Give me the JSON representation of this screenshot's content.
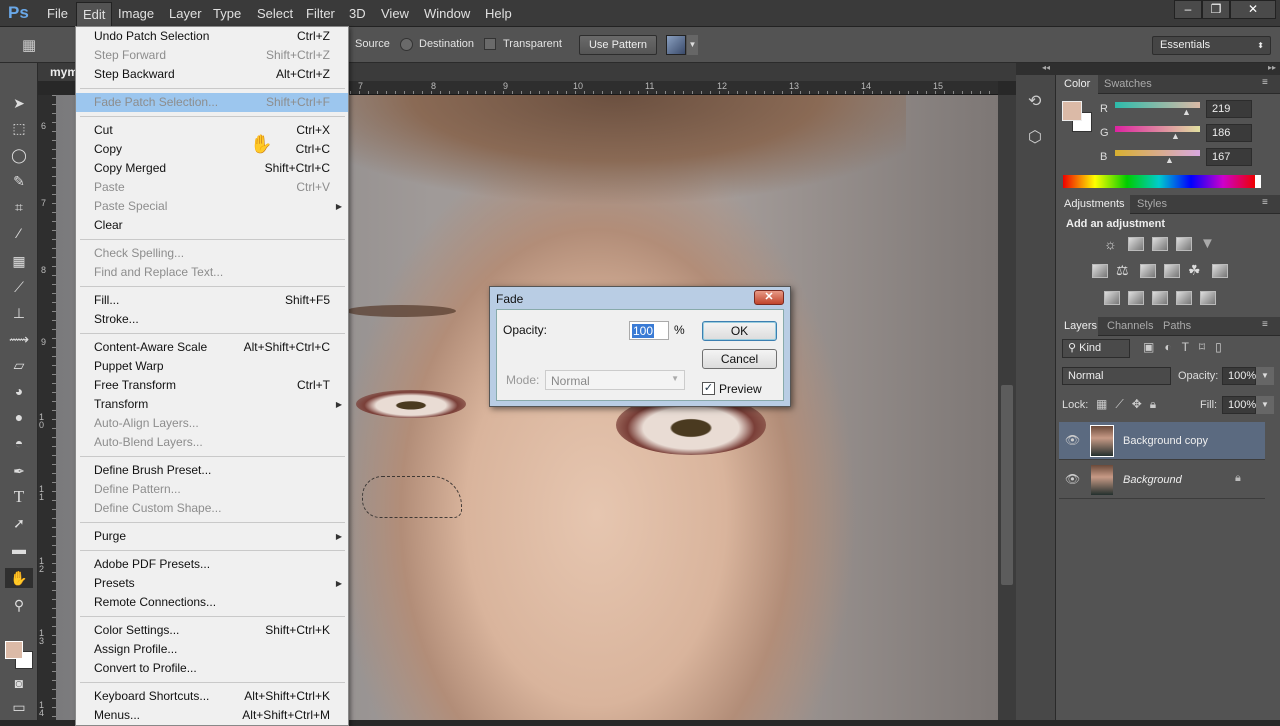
{
  "app": {
    "logo": "Ps",
    "window_controls": [
      "–",
      "❐",
      "✕"
    ]
  },
  "menubar": [
    "File",
    "Edit",
    "Image",
    "Layer",
    "Type",
    "Select",
    "Filter",
    "3D",
    "View",
    "Window",
    "Help"
  ],
  "options": {
    "source": "Source",
    "destination": "Destination",
    "transparent": "Transparent",
    "use_pattern": "Use Pattern",
    "workspace": "Essentials"
  },
  "document": {
    "tab": "mym"
  },
  "rulers": {
    "h": [
      "7",
      "8",
      "9",
      "10",
      "11",
      "12",
      "13",
      "14",
      "15"
    ],
    "v": [
      "6",
      "7",
      "8",
      "9",
      "10",
      "11",
      "12",
      "13",
      "14"
    ]
  },
  "edit_menu": [
    {
      "label": "Undo Patch Selection",
      "shortcut": "Ctrl+Z"
    },
    {
      "label": "Step Forward",
      "shortcut": "Shift+Ctrl+Z",
      "disabled": true
    },
    {
      "label": "Step Backward",
      "shortcut": "Alt+Ctrl+Z"
    },
    {
      "sep": true
    },
    {
      "label": "Fade Patch Selection...",
      "shortcut": "Shift+Ctrl+F",
      "highlight": true
    },
    {
      "sep": true
    },
    {
      "label": "Cut",
      "shortcut": "Ctrl+X"
    },
    {
      "label": "Copy",
      "shortcut": "Ctrl+C"
    },
    {
      "label": "Copy Merged",
      "shortcut": "Shift+Ctrl+C"
    },
    {
      "label": "Paste",
      "shortcut": "Ctrl+V",
      "disabled": true
    },
    {
      "label": "Paste Special",
      "submenu": true,
      "disabled": true
    },
    {
      "label": "Clear"
    },
    {
      "sep": true
    },
    {
      "label": "Check Spelling...",
      "disabled": true
    },
    {
      "label": "Find and Replace Text...",
      "disabled": true
    },
    {
      "sep": true
    },
    {
      "label": "Fill...",
      "shortcut": "Shift+F5"
    },
    {
      "label": "Stroke..."
    },
    {
      "sep": true
    },
    {
      "label": "Content-Aware Scale",
      "shortcut": "Alt+Shift+Ctrl+C"
    },
    {
      "label": "Puppet Warp"
    },
    {
      "label": "Free Transform",
      "shortcut": "Ctrl+T"
    },
    {
      "label": "Transform",
      "submenu": true
    },
    {
      "label": "Auto-Align Layers...",
      "disabled": true
    },
    {
      "label": "Auto-Blend Layers...",
      "disabled": true
    },
    {
      "sep": true
    },
    {
      "label": "Define Brush Preset..."
    },
    {
      "label": "Define Pattern...",
      "disabled": true
    },
    {
      "label": "Define Custom Shape...",
      "disabled": true
    },
    {
      "sep": true
    },
    {
      "label": "Purge",
      "submenu": true
    },
    {
      "sep": true
    },
    {
      "label": "Adobe PDF Presets..."
    },
    {
      "label": "Presets",
      "submenu": true
    },
    {
      "label": "Remote Connections..."
    },
    {
      "sep": true
    },
    {
      "label": "Color Settings...",
      "shortcut": "Shift+Ctrl+K"
    },
    {
      "label": "Assign Profile..."
    },
    {
      "label": "Convert to Profile..."
    },
    {
      "sep": true
    },
    {
      "label": "Keyboard Shortcuts...",
      "shortcut": "Alt+Shift+Ctrl+K"
    },
    {
      "label": "Menus...",
      "shortcut": "Alt+Shift+Ctrl+M"
    }
  ],
  "fade_dialog": {
    "title": "Fade",
    "opacity_label": "Opacity:",
    "opacity_value": "100",
    "percent": "%",
    "ok": "OK",
    "cancel": "Cancel",
    "mode_label": "Mode:",
    "mode_value": "Normal",
    "preview_label": "Preview",
    "preview_checked": true
  },
  "color_panel": {
    "tabs": [
      "Color",
      "Swatches"
    ],
    "r_label": "R",
    "g_label": "G",
    "b_label": "B",
    "r": "219",
    "g": "186",
    "b": "167",
    "foreground": "#dbbaa7"
  },
  "adjustments_panel": {
    "tabs": [
      "Adjustments",
      "Styles"
    ],
    "heading": "Add an adjustment"
  },
  "layers_panel": {
    "tabs": [
      "Layers",
      "Channels",
      "Paths"
    ],
    "filter": "Kind",
    "blend_mode": "Normal",
    "opacity_label": "Opacity:",
    "opacity": "100%",
    "lock_label": "Lock:",
    "fill_label": "Fill:",
    "fill": "100%",
    "layers": [
      {
        "name": "Background copy",
        "selected": true
      },
      {
        "name": "Background",
        "locked": true
      }
    ]
  }
}
